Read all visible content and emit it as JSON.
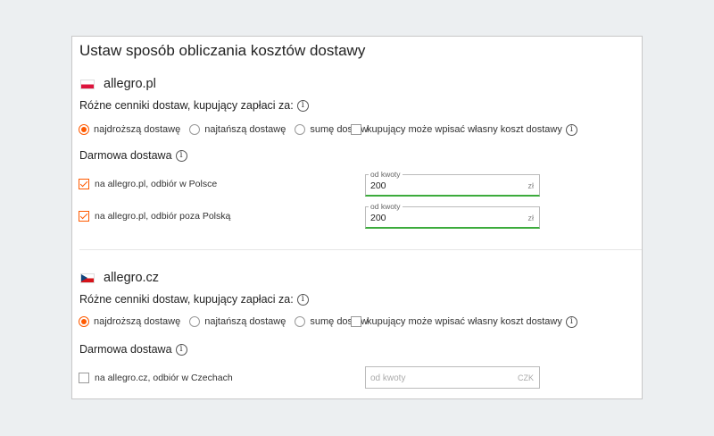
{
  "page_title": "Ustaw sposób obliczania kosztów dostawy",
  "colors": {
    "accent": "#ff5a00",
    "active_border": "#3cab3c"
  },
  "sections": [
    {
      "site": "allegro.pl",
      "flag": "poland-flag-icon",
      "pricing_label": "Różne cenniki dostaw, kupujący zapłaci za:",
      "options": [
        {
          "label": "najdroższą dostawę",
          "selected": true
        },
        {
          "label": "najtańszą dostawę",
          "selected": false
        },
        {
          "label": "sumę dostaw",
          "selected": false
        }
      ],
      "own_cost": {
        "label": "kupujący może wpisać własny koszt dostawy",
        "checked": false
      },
      "free_label": "Darmowa dostawa",
      "free_rows": [
        {
          "label": "na allegro.pl, odbiór w Polsce",
          "checked": true,
          "field_label": "od kwoty",
          "value": "200",
          "unit": "zł"
        },
        {
          "label": "na allegro.pl, odbiór poza Polską",
          "checked": true,
          "field_label": "od kwoty",
          "value": "200",
          "unit": "zł"
        }
      ]
    },
    {
      "site": "allegro.cz",
      "flag": "czech-flag-icon",
      "pricing_label": "Różne cenniki dostaw, kupujący zapłaci za:",
      "options": [
        {
          "label": "najdroższą dostawę",
          "selected": true
        },
        {
          "label": "najtańszą dostawę",
          "selected": false
        },
        {
          "label": "sumę dostaw",
          "selected": false
        }
      ],
      "own_cost": {
        "label": "kupujący może wpisać własny koszt dostawy",
        "checked": false
      },
      "free_label": "Darmowa dostawa",
      "free_rows": [
        {
          "label": "na allegro.cz, odbiór w Czechach",
          "checked": false,
          "placeholder": "od kwoty",
          "value": "",
          "unit": "CZK"
        }
      ]
    }
  ]
}
